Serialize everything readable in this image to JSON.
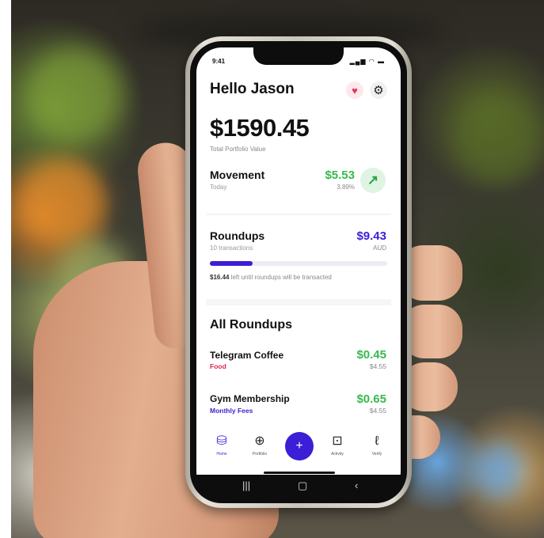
{
  "status": {
    "time": "9:41",
    "icons": "‥… ▤"
  },
  "header": {
    "greeting": "Hello Jason"
  },
  "portfolio": {
    "value": "$1590.45",
    "label": "Total Portfolio Value"
  },
  "movement": {
    "title": "Movement",
    "period": "Today",
    "amount": "$5.53",
    "percent": "3.89%"
  },
  "roundups": {
    "title": "Roundups",
    "transactions": "10 transactions",
    "amount": "$9.43",
    "currency": "AUD",
    "progress": 0.24,
    "note_amount": "$16.44",
    "note_text": " left until roundups will be transacted"
  },
  "all_roundups": {
    "title": "All Roundups",
    "items": [
      {
        "name": "Telegram Coffee",
        "category": "Food",
        "category_color": "#e02450",
        "amount": "$0.45",
        "original": "$4.55"
      },
      {
        "name": "Gym Membership",
        "category": "Monthly Fees",
        "category_color": "#3a1fd6",
        "amount": "$0.65",
        "original": "$4.55"
      }
    ]
  },
  "nav": {
    "items": [
      {
        "label": "Home",
        "icon": "coins-icon"
      },
      {
        "label": "Portfolio",
        "icon": "globe-icon"
      },
      {
        "label": "Activity",
        "icon": "money-icon"
      },
      {
        "label": "Verify",
        "icon": "branch-icon"
      }
    ],
    "add_icon": "plus-icon"
  },
  "colors": {
    "accent": "#3a1fd6",
    "positive": "#37b94f",
    "heart": "#e8355a"
  }
}
